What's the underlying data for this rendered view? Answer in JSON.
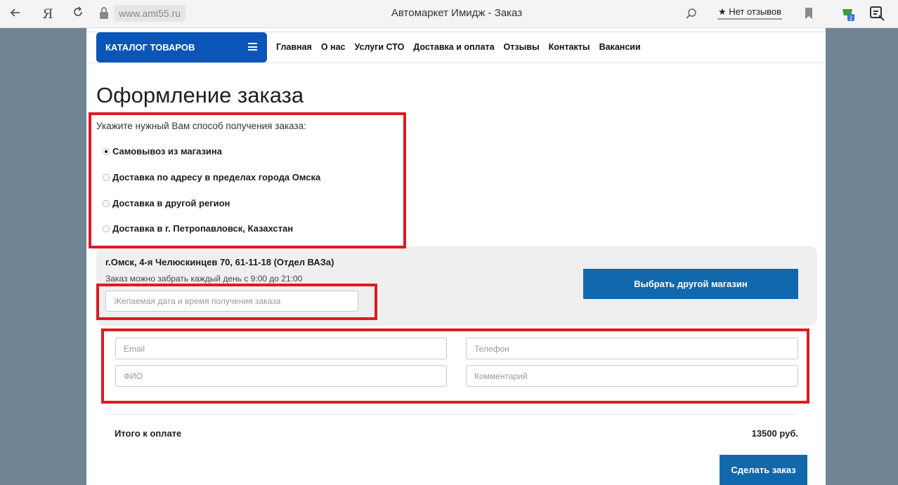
{
  "browser": {
    "url": "www.ami55.ru",
    "tab_title": "Автомаркет Имидж - Заказ",
    "reviews_label": "★ Нет отзывов",
    "yandex_label": "Я"
  },
  "header": {
    "catalog_label": "КАТАЛОГ ТОВАРОВ",
    "nav": [
      "Главная",
      "О нас",
      "Услуги СТО",
      "Доставка и оплата",
      "Отзывы",
      "Контакты",
      "Вакансии"
    ]
  },
  "main": {
    "title": "Оформление заказа",
    "delivery_prompt": "Укажите нужный Вам способ получения заказа:",
    "delivery_options": [
      {
        "label": "Самовывоз из магазина",
        "selected": true
      },
      {
        "label": "Доставка по адресу в пределах города Омска",
        "selected": false
      },
      {
        "label": "Доставка в другой регион",
        "selected": false
      },
      {
        "label": "Доставка в г. Петропавловск, Казахстан",
        "selected": false
      }
    ],
    "store": {
      "address": "г.Омск, 4-я Челюскинцев 70, 61-11-18 (Отдел ВАЗа)",
      "hours": "Заказ можно забрать каждый день с 9:00 до 21:00",
      "choose_label": "Выбрать другой магазин",
      "date_placeholder": "Желаемая дата и время получения заказа"
    },
    "form": {
      "email_placeholder": "Email",
      "phone_placeholder": "Телефон",
      "fio_placeholder": "ФИО",
      "comment_placeholder": "Комментарий"
    },
    "total": {
      "label": "Итого к оплате",
      "value": "13500 руб."
    },
    "submit_label": "Сделать заказ"
  },
  "colors": {
    "brand_blue": "#0b55b6",
    "button_blue": "#1268ac",
    "highlight_red": "#dc1b25"
  }
}
